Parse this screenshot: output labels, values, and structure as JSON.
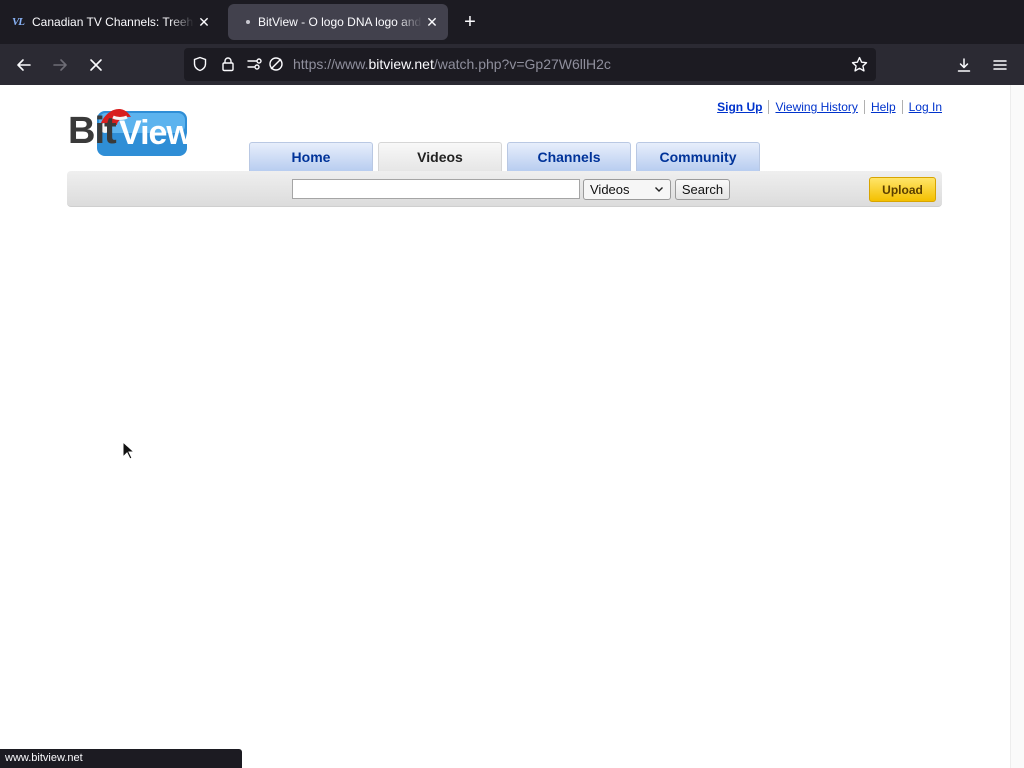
{
  "browser": {
    "tabs": [
      {
        "title": "Canadian TV Channels: Treehou",
        "favicon": "VL",
        "active": false
      },
      {
        "title": "BitView - O logo DNA logo and N",
        "active": true
      }
    ],
    "url_prefix": "https://www.",
    "url_domain": "bitview.net",
    "url_path": "/watch.php?v=Gp27W6llH2c",
    "status_text": "www.bitview.net"
  },
  "site": {
    "logo_text_bit": "Bit",
    "logo_text_view": "View",
    "top_links": {
      "sign_up": "Sign Up",
      "viewing_history": "Viewing History",
      "help": "Help",
      "log_in": "Log In"
    },
    "nav_tabs": [
      {
        "label": "Home",
        "selected": false
      },
      {
        "label": "Videos",
        "selected": true
      },
      {
        "label": "Channels",
        "selected": false
      },
      {
        "label": "Community",
        "selected": false
      }
    ],
    "search": {
      "value": "",
      "select_value": "Videos",
      "button_label": "Search"
    },
    "upload_label": "Upload"
  },
  "colors": {
    "link": "#0033cc",
    "tab_text": "#003399",
    "upload_bg": "#f4c000"
  }
}
